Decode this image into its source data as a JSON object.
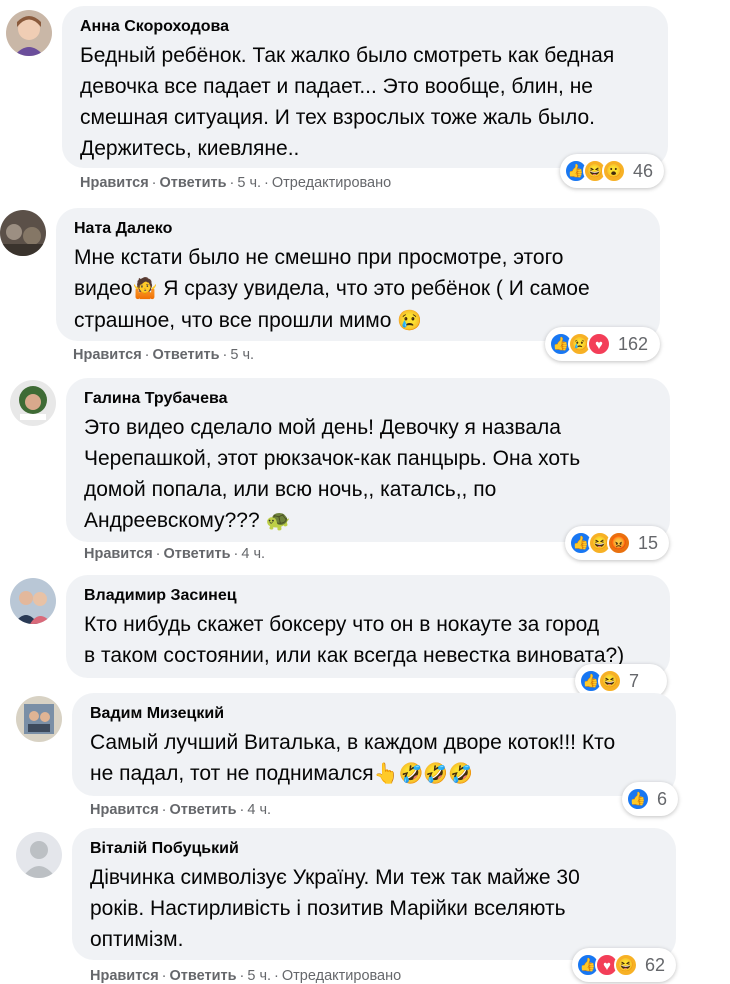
{
  "comments": [
    {
      "author": "Анна Скороходова",
      "text": "Бедный ребёнок. Так жалко было смотреть как бедная\nдевочка все падает и падает... Это вообще, блин, не\nсмешная ситуация. И тех взрослых тоже жаль было.\nДержитесь, киевляне..",
      "like": "Нравится",
      "reply": "Ответить",
      "time": "5 ч.",
      "edited": "Отредактировано",
      "reaction_count": "46",
      "reaction_icons": [
        "like-icon",
        "haha-icon",
        "wow-icon"
      ]
    },
    {
      "author": "Ната Далеко",
      "text_line1": "Мне кстати было не смешно при просмотре, этого",
      "text_line2a": "видео",
      "emoji1": "🤷",
      "text_line2b": " Я сразу увидела, что это ребёнок ( И самое",
      "text_line3": "страшное, что все прошли мимо ",
      "emoji2": "😢",
      "like": "Нравится",
      "reply": "Ответить",
      "time": "5 ч.",
      "reaction_count": "162",
      "reaction_icons": [
        "like-icon",
        "sad-icon",
        "love-icon"
      ]
    },
    {
      "author": "Галина Трубачева",
      "text": "Это видео сделало мой день! Девочку я назвала\nЧерепашкой, этот рюкзачок-как панцырь. Она хоть\nдомой попала, или всю ночь,, каталсь,, по\nАндреевскому??? ",
      "emoji": "🐢",
      "like": "Нравится",
      "reply": "Ответить",
      "time": "4 ч.",
      "reaction_count": "15",
      "reaction_icons": [
        "like-icon",
        "haha-icon",
        "angry-icon"
      ]
    },
    {
      "author": "Владимир Засинец",
      "text": "Кто нибудь скажет боксеру что он в нокауте за город\nв таком состоянии, или как всегда невестка виновата?)",
      "reaction_count": "7",
      "reaction_icons": [
        "like-icon",
        "haha-icon"
      ]
    },
    {
      "author": "Вадим Мизецкий",
      "text_line1": "Самый лучший Виталька, в каждом дворе коток!!! Кто",
      "text_line2": "не падал, тот не поднимался",
      "emoji": "👆🤣🤣🤣",
      "like": "Нравится",
      "reply": "Ответить",
      "time": "4 ч.",
      "reaction_count": "6",
      "reaction_icons": [
        "like-icon"
      ]
    },
    {
      "author": "Віталій Побуцький",
      "text": "Дівчинка символізує Україну. Ми теж так майже 30\nроків. Настирливість і позитив Марійки вселяють\nоптимізм.",
      "like": "Нравится",
      "reply": "Ответить",
      "time": "5 ч.",
      "edited": "Отредактировано",
      "reaction_count": "62",
      "reaction_icons": [
        "like-icon",
        "love-icon",
        "haha-icon"
      ]
    }
  ],
  "colors": {
    "bubble": "#f0f2f5",
    "meta": "#65676b",
    "like": "#1877f2",
    "love": "#f33e58",
    "haha": "#f7b125",
    "angry": "#e9710f"
  }
}
